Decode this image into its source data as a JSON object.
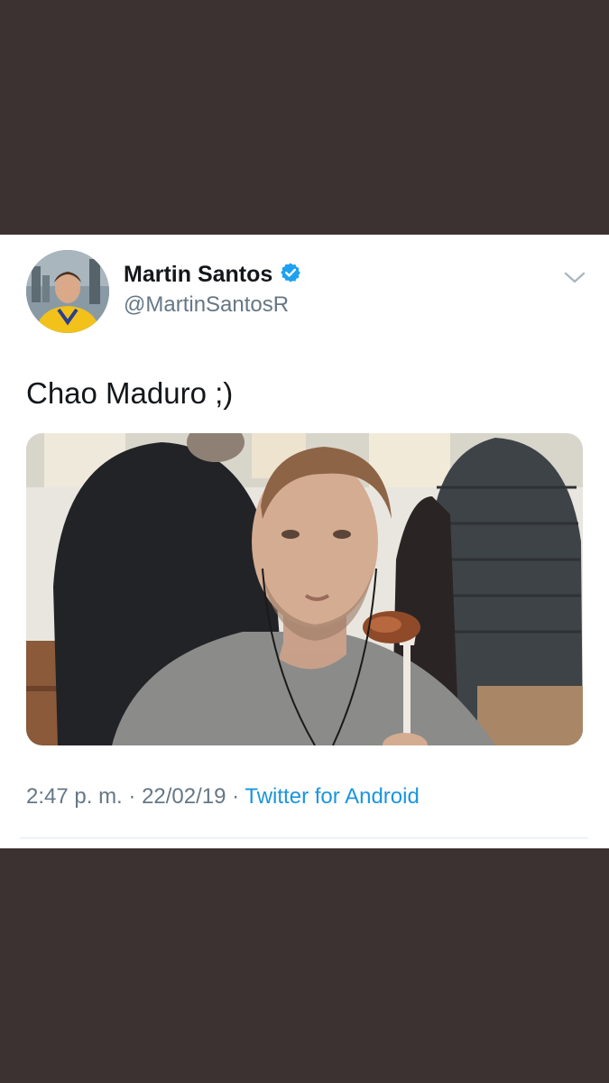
{
  "tweet": {
    "author_name": "Martin Santos",
    "verified_icon": "verified-badge-icon",
    "handle": "@MartinSantosR",
    "text": "Chao Maduro ;)",
    "time": "2:47 p. m.",
    "sep1": " · ",
    "date": "22/02/19",
    "sep2": " · ",
    "source": "Twitter for Android"
  },
  "icons": {
    "menu": "chevron-down-icon"
  },
  "colors": {
    "background": "#3b3231",
    "card": "#ffffff",
    "link": "#1b95e0",
    "secondary_text": "#657786",
    "verified": "#1da1f2"
  }
}
